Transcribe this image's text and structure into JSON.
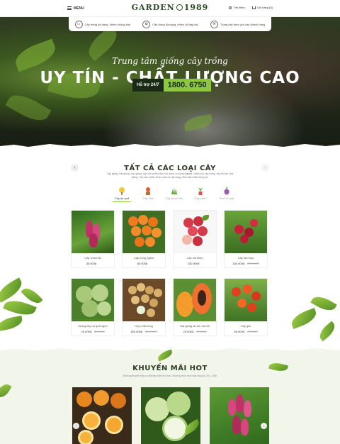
{
  "header": {
    "menu_label": "MENU",
    "logo_left": "GARDEN",
    "logo_right": "1989",
    "search_label": "Tìm kiếm",
    "cart_label": "Giỏ hàng (0)"
  },
  "features": [
    {
      "icon": "truck-icon",
      "label": "Cây trồng đa dạng, nhiều chủng loại"
    },
    {
      "icon": "plant-pot-icon",
      "label": "Cây trồng đa dạng, nhiều chủng loại"
    },
    {
      "icon": "tools-icon",
      "label": "Trồng cây theo yêu cầu khách hàng"
    }
  ],
  "hero": {
    "subtitle": "Trung tâm giống cây trồng",
    "title": "UY TÍN - CHẤT LƯỢNG CAO",
    "hotline_label": "Hỗ trợ 24/7",
    "hotline_number": "1800. 6750"
  },
  "categories": {
    "title": "TẤT CẢ CÁC LOẠI CÂY",
    "description": "Cây giống, hạt giống, cao giống, các chế phẩm sinh học phục vụ nông nghiệp, chăm sóc cây trồng, cây ăn trái, hoa kiểng. Các sản phẩm được chọn lọc kỹ càng, đảm bảo chất lượng tốt.",
    "tabs": [
      {
        "label": "Cây ăn quả",
        "icon": "fruit-tree-icon",
        "active": true
      },
      {
        "label": "Cây hoa",
        "icon": "flower-pot-icon",
        "active": false
      },
      {
        "label": "Cây dược liệu",
        "icon": "herb-icon",
        "active": false
      },
      {
        "label": "Cây cảnh",
        "icon": "ornamental-plant-icon",
        "active": false
      },
      {
        "label": "Rau củ quả",
        "icon": "vegetable-icon",
        "active": false
      }
    ],
    "products": [
      {
        "name": "Cây chuối đỏ",
        "price": "35.000đ",
        "old_price": ""
      },
      {
        "name": "Cây hồng ngâm",
        "price": "80.000đ",
        "old_price": ""
      },
      {
        "name": "Cây vải thiều",
        "price": "230.000đ",
        "old_price": ""
      },
      {
        "name": "Cây tầm bóp",
        "price": "150.000đ",
        "old_price": "230.000đ"
      },
      {
        "name": "Giống cây na quả ngon",
        "price": "20.000đ",
        "old_price": "35.000đ"
      },
      {
        "name": "Cây nhãn lồng",
        "price": "260.000đ",
        "old_price": "300.000đ"
      },
      {
        "name": "Hạt giống đu đủ ruột đỏ",
        "price": "25.000đ",
        "old_price": "70.000đ"
      },
      {
        "name": "Cây gấc",
        "price": "50.000đ",
        "old_price": "70.000đ"
      }
    ]
  },
  "promo": {
    "title": "KHUYẾN MÃI HOT",
    "description": "Những khuyến mãi ưu đãi đặc biệt cho bạn, chương trình được áp dụng từ 2/5 - 30/6"
  }
}
